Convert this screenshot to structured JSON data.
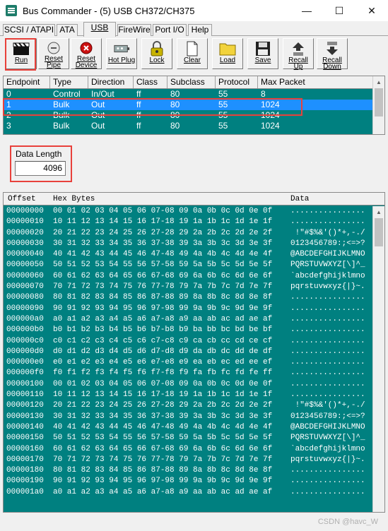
{
  "window": {
    "title": "Bus Commander - (5) USB CH372/CH375",
    "minimize_glyph": "—",
    "maximize_glyph": "☐",
    "close_glyph": "✕"
  },
  "tabs": [
    {
      "label": "SCSI / ATAPI",
      "active": false
    },
    {
      "label": "ATA",
      "active": false
    },
    {
      "label": "USB",
      "active": true
    },
    {
      "label": "FireWire",
      "active": false
    },
    {
      "label": "Port I/O",
      "active": false
    },
    {
      "label": "Help",
      "active": false
    }
  ],
  "toolbar": {
    "buttons": [
      {
        "label1": "Run",
        "label2": "",
        "icon": "clapperboard-icon"
      },
      {
        "label1": "Reset",
        "label2": "Pipe",
        "icon": "reset-pipe-icon"
      },
      {
        "label1": "Reset",
        "label2": "Device",
        "icon": "reset-device-icon"
      },
      {
        "label1": "Hot Plug",
        "label2": "",
        "icon": "hot-plug-icon"
      },
      {
        "label1": "Lock",
        "label2": "",
        "icon": "lock-icon"
      },
      {
        "label1": "Clear",
        "label2": "",
        "icon": "clear-icon"
      },
      {
        "label1": "Load",
        "label2": "",
        "icon": "folder-icon"
      },
      {
        "label1": "Save",
        "label2": "",
        "icon": "floppy-icon"
      },
      {
        "label1": "Recall",
        "label2": "Up",
        "icon": "recall-up-icon"
      },
      {
        "label1": "Recall",
        "label2": "Down",
        "icon": "recall-down-icon"
      }
    ]
  },
  "endpoints": {
    "columns": [
      "Endpoint",
      "Type",
      "Direction",
      "Class",
      "Subclass",
      "Protocol",
      "Max Packet"
    ],
    "rows": [
      [
        "0",
        "Control",
        "In/Out",
        "ff",
        "80",
        "55",
        "8"
      ],
      [
        "1",
        "Bulk",
        "Out",
        "ff",
        "80",
        "55",
        "1024"
      ],
      [
        "2",
        "Bulk",
        "Out",
        "ff",
        "80",
        "55",
        "1024"
      ],
      [
        "3",
        "Bulk",
        "Out",
        "ff",
        "80",
        "55",
        "1024"
      ]
    ],
    "selected_index": 1
  },
  "data_length": {
    "label": "Data Length",
    "value": "4096"
  },
  "hex_view": {
    "headers": {
      "offset": "Offset",
      "hex": "Hex Bytes",
      "data": "Data"
    },
    "rows": [
      {
        "offset": "00000000",
        "hex": "00 01 02 03 04 05 06 07-08 09 0a 0b 0c 0d 0e 0f",
        "data": "................"
      },
      {
        "offset": "00000010",
        "hex": "10 11 12 13 14 15 16 17-18 19 1a 1b 1c 1d 1e 1f",
        "data": "................"
      },
      {
        "offset": "00000020",
        "hex": "20 21 22 23 24 25 26 27-28 29 2a 2b 2c 2d 2e 2f",
        "data": " !\"#$%&'()*+,-./"
      },
      {
        "offset": "00000030",
        "hex": "30 31 32 33 34 35 36 37-38 39 3a 3b 3c 3d 3e 3f",
        "data": "0123456789:;<=>?"
      },
      {
        "offset": "00000040",
        "hex": "40 41 42 43 44 45 46 47-48 49 4a 4b 4c 4d 4e 4f",
        "data": "@ABCDEFGHIJKLMNO"
      },
      {
        "offset": "00000050",
        "hex": "50 51 52 53 54 55 56 57-58 59 5a 5b 5c 5d 5e 5f",
        "data": "PQRSTUVWXYZ[\\]^_"
      },
      {
        "offset": "00000060",
        "hex": "60 61 62 63 64 65 66 67-68 69 6a 6b 6c 6d 6e 6f",
        "data": "`abcdefghijklmno"
      },
      {
        "offset": "00000070",
        "hex": "70 71 72 73 74 75 76 77-78 79 7a 7b 7c 7d 7e 7f",
        "data": "pqrstuvwxyz{|}~."
      },
      {
        "offset": "00000080",
        "hex": "80 81 82 83 84 85 86 87-88 89 8a 8b 8c 8d 8e 8f",
        "data": "................"
      },
      {
        "offset": "00000090",
        "hex": "90 91 92 93 94 95 96 97-98 99 9a 9b 9c 9d 9e 9f",
        "data": "................"
      },
      {
        "offset": "000000a0",
        "hex": "a0 a1 a2 a3 a4 a5 a6 a7-a8 a9 aa ab ac ad ae af",
        "data": "................"
      },
      {
        "offset": "000000b0",
        "hex": "b0 b1 b2 b3 b4 b5 b6 b7-b8 b9 ba bb bc bd be bf",
        "data": "................"
      },
      {
        "offset": "000000c0",
        "hex": "c0 c1 c2 c3 c4 c5 c6 c7-c8 c9 ca cb cc cd ce cf",
        "data": "................"
      },
      {
        "offset": "000000d0",
        "hex": "d0 d1 d2 d3 d4 d5 d6 d7-d8 d9 da db dc dd de df",
        "data": "................"
      },
      {
        "offset": "000000e0",
        "hex": "e0 e1 e2 e3 e4 e5 e6 e7-e8 e9 ea eb ec ed ee ef",
        "data": "................"
      },
      {
        "offset": "000000f0",
        "hex": "f0 f1 f2 f3 f4 f5 f6 f7-f8 f9 fa fb fc fd fe ff",
        "data": "................"
      },
      {
        "offset": "00000100",
        "hex": "00 01 02 03 04 05 06 07-08 09 0a 0b 0c 0d 0e 0f",
        "data": "................"
      },
      {
        "offset": "00000110",
        "hex": "10 11 12 13 14 15 16 17-18 19 1a 1b 1c 1d 1e 1f",
        "data": "................"
      },
      {
        "offset": "00000120",
        "hex": "20 21 22 23 24 25 26 27-28 29 2a 2b 2c 2d 2e 2f",
        "data": " !\"#$%&'()*+,-./"
      },
      {
        "offset": "00000130",
        "hex": "30 31 32 33 34 35 36 37-38 39 3a 3b 3c 3d 3e 3f",
        "data": "0123456789:;<=>?"
      },
      {
        "offset": "00000140",
        "hex": "40 41 42 43 44 45 46 47-48 49 4a 4b 4c 4d 4e 4f",
        "data": "@ABCDEFGHIJKLMNO"
      },
      {
        "offset": "00000150",
        "hex": "50 51 52 53 54 55 56 57-58 59 5a 5b 5c 5d 5e 5f",
        "data": "PQRSTUVWXYZ[\\]^_"
      },
      {
        "offset": "00000160",
        "hex": "60 61 62 63 64 65 66 67-68 69 6a 6b 6c 6d 6e 6f",
        "data": "`abcdefghijklmno"
      },
      {
        "offset": "00000170",
        "hex": "70 71 72 73 74 75 76 77-78 79 7a 7b 7c 7d 7e 7f",
        "data": "pqrstuvwxyz{|}~."
      },
      {
        "offset": "00000180",
        "hex": "80 81 82 83 84 85 86 87-88 89 8a 8b 8c 8d 8e 8f",
        "data": "................"
      },
      {
        "offset": "00000190",
        "hex": "90 91 92 93 94 95 96 97-98 99 9a 9b 9c 9d 9e 9f",
        "data": "................"
      },
      {
        "offset": "000001a0",
        "hex": "a0 a1 a2 a3 a4 a5 a6 a7-a8 a9 aa ab ac ad ae af",
        "data": "................"
      }
    ]
  },
  "watermark": "CSDN @havc_W",
  "colors": {
    "teal": "#008080",
    "selection": "#1e90ff",
    "highlight_red": "#e8413b"
  }
}
